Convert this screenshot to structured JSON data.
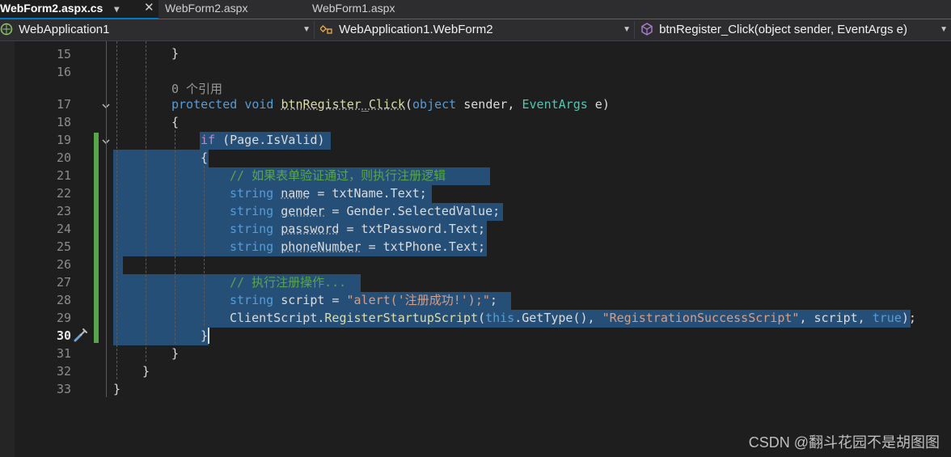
{
  "tabs": [
    {
      "label": "WebForm2.aspx.cs",
      "active": true
    },
    {
      "label": "WebForm2.aspx",
      "active": false
    },
    {
      "label": "WebForm1.aspx",
      "active": false
    }
  ],
  "navbar": {
    "project": "WebApplication1",
    "class": "WebApplication1.WebForm2",
    "member": "btnRegister_Click(object sender, EventArgs e)"
  },
  "editor": {
    "line_numbers": [
      "15",
      "16",
      "17",
      "18",
      "19",
      "20",
      "21",
      "22",
      "23",
      "24",
      "25",
      "26",
      "27",
      "28",
      "29",
      "30",
      "31",
      "32",
      "33"
    ],
    "current_line": "30",
    "codelens": "0 个引用",
    "lines": {
      "l15": "}",
      "l17_kw1": "protected",
      "l17_kw2": "void",
      "l17_name": "btnRegister_Click",
      "l17_rest1": "(",
      "l17_kw3": "object",
      "l17_arg1": " sender, ",
      "l17_type": "EventArgs",
      "l17_rest2": " e)",
      "l18": "{",
      "l19_kw": "if",
      "l19_rest": " (Page.IsValid)",
      "l20": "{",
      "l21": "// 如果表单验证通过，则执行注册逻辑",
      "l22_kw": "string",
      "l22_var": "name",
      "l22_rest": " = txtName.Text;",
      "l23_kw": "string",
      "l23_var": "gender",
      "l23_rest": " = Gender.SelectedValue;",
      "l24_kw": "string",
      "l24_var": "password",
      "l24_rest": " = txtPassword.Text;",
      "l25_kw": "string",
      "l25_var": "phoneNumber",
      "l25_rest": " = txtPhone.Text;",
      "l27": "// 执行注册操作...",
      "l28_kw": "string",
      "l28_rest": " script = ",
      "l28_str": "\"alert('注册成功!');\"",
      "l28_end": ";",
      "l29_a": "ClientScript.",
      "l29_fn": "RegisterStartupScript",
      "l29_b": "(",
      "l29_kw1": "this",
      "l29_c": ".GetType(), ",
      "l29_str": "\"RegistrationSuccessScript\"",
      "l29_d": ", script, ",
      "l29_kw2": "true",
      "l29_e": ");",
      "l30": "}",
      "l31": "}",
      "l32": "}",
      "l33": "}"
    }
  },
  "watermark": "CSDN @翻斗花园不是胡图图",
  "colors": {
    "accent": "#007acc",
    "selection": "#264f78",
    "change_bar": "#57a64a",
    "keyword": "#569cd6",
    "type": "#4ec9b0",
    "comment": "#57a64a",
    "string": "#d69d85"
  },
  "icons": [
    "csharp-project-icon",
    "class-icon",
    "method-icon",
    "quick-actions-icon",
    "chevron-down-icon",
    "close-icon",
    "pin-icon"
  ]
}
